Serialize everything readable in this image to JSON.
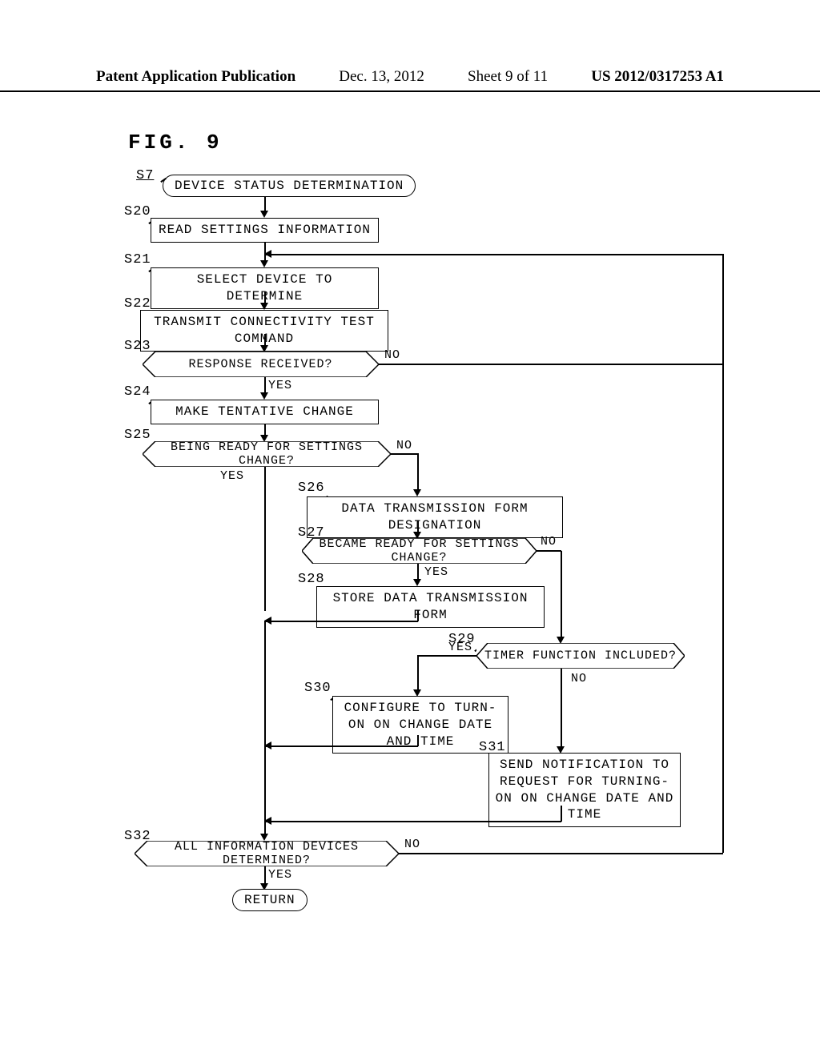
{
  "header": {
    "publication_label": "Patent Application Publication",
    "date": "Dec. 13, 2012",
    "sheet": "Sheet 9 of 11",
    "pub_number": "US 2012/0317253 A1"
  },
  "figure_label": "FIG. 9",
  "steps": {
    "s7": {
      "label": "S7",
      "text": "DEVICE STATUS DETERMINATION"
    },
    "s20": {
      "label": "S20",
      "text": "READ SETTINGS INFORMATION"
    },
    "s21": {
      "label": "S21",
      "text": "SELECT DEVICE TO DETERMINE"
    },
    "s22": {
      "label": "S22",
      "text": "TRANSMIT CONNECTIVITY TEST COMMAND"
    },
    "s23": {
      "label": "S23",
      "text": "RESPONSE RECEIVED?"
    },
    "s24": {
      "label": "S24",
      "text": "MAKE TENTATIVE CHANGE"
    },
    "s25": {
      "label": "S25",
      "text": "BEING READY FOR SETTINGS CHANGE?"
    },
    "s26": {
      "label": "S26",
      "text": "DATA TRANSMISSION FORM DESIGNATION"
    },
    "s27": {
      "label": "S27",
      "text": "BECAME READY FOR SETTINGS CHANGE?"
    },
    "s28": {
      "label": "S28",
      "text": "STORE DATA TRANSMISSION FORM"
    },
    "s29": {
      "label": "S29",
      "text": "TIMER FUNCTION INCLUDED?"
    },
    "s30": {
      "label": "S30",
      "text": "CONFIGURE TO TURN-ON ON CHANGE DATE AND TIME"
    },
    "s31": {
      "label": "S31",
      "text": "SEND NOTIFICATION TO REQUEST FOR TURNING-ON ON CHANGE DATE AND TIME"
    },
    "s32": {
      "label": "S32",
      "text": "ALL INFORMATION DEVICES DETERMINED?"
    }
  },
  "branches": {
    "yes": "YES",
    "no": "NO"
  },
  "return_label": "RETURN"
}
